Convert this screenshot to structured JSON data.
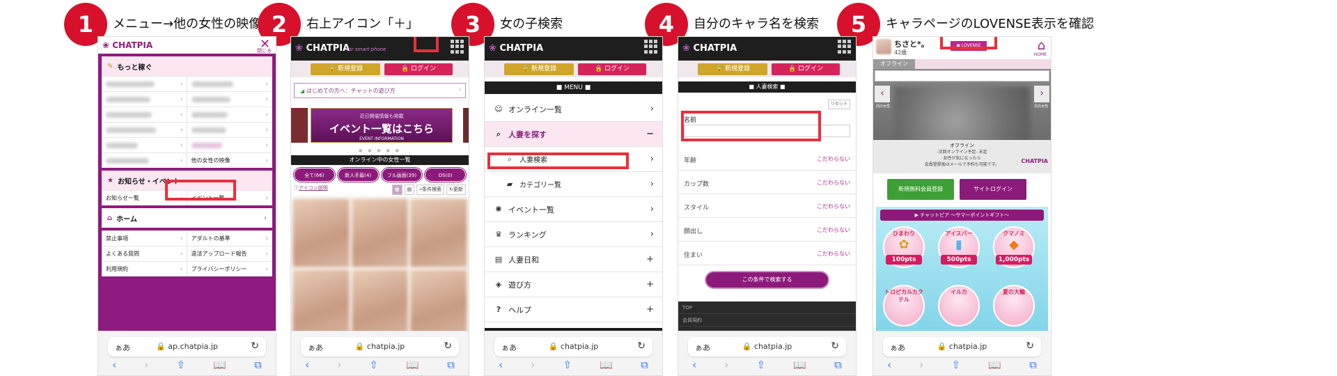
{
  "steps": [
    {
      "number": "1",
      "caption": "メニュー→他の女性の映像"
    },
    {
      "number": "2",
      "caption": "右上アイコン「＋」"
    },
    {
      "number": "3",
      "caption": "女の子検索"
    },
    {
      "number": "4",
      "caption": "自分のキャラ名を検索"
    },
    {
      "number": "5",
      "caption": "キャラページのLOVENSE表示を確認"
    }
  ],
  "colors": {
    "accent": "#d7112b",
    "brand": "#8e1b7f",
    "highlight": "#e8303a"
  },
  "browser": {
    "aa_label": "ぁあ",
    "reload_icon": "reload-icon",
    "back": "‹",
    "forward": "›",
    "share": "⇧",
    "bookmarks": "📖",
    "tabs": "⧉"
  },
  "phone1": {
    "logo": "CHATPIA",
    "close_label": "閉じる",
    "sections": [
      {
        "title": "もっと稼ぐ",
        "cells": [
          "",
          "",
          "",
          "",
          "",
          "",
          "",
          "",
          "",
          "",
          "",
          "他の女性の映像"
        ]
      },
      {
        "title": "お知らせ・イベント",
        "cells": [
          "お知らせ一覧",
          "イベント一覧"
        ]
      },
      {
        "title": "ホーム",
        "cells": []
      },
      {
        "title": "",
        "cells": [
          "禁止事項",
          "アダルトの基準",
          "よくある質問",
          "違法アップロード報告",
          "利用規約",
          "プライバシーポリシー"
        ]
      }
    ],
    "url": "ap.chatpia.jp"
  },
  "phone2": {
    "logo": "CHATPIA",
    "tagline": "for smart phone",
    "register": "新規登録",
    "login": "ログイン",
    "info_link": "はじめての方へ：チャットの遊び方",
    "banner_small": "近日開催情報も掲載",
    "banner_big": "イベント一覧はこちら",
    "banner_en": "EVENT INFORMATION",
    "online_title": "オンライン中の女性一覧",
    "pills": [
      "全て(66)",
      "新人手篇(4)",
      "フル画面(39)",
      "DS(0)"
    ],
    "icon_help": "アイコン説明",
    "cond_search": "条件検索",
    "refresh": "更新",
    "url": "chatpia.jp"
  },
  "phone3": {
    "logo": "CHATPIA",
    "register": "新規登録",
    "login": "ログイン",
    "menu_title": "MENU",
    "items": [
      {
        "label": "オンライン一覧",
        "end": "›",
        "icon": "user-icon"
      },
      {
        "label": "人妻を探す",
        "end": "−",
        "icon": "search-icon"
      },
      {
        "label": "人妻検索",
        "end": "›",
        "icon": "search-icon"
      },
      {
        "label": "カテゴリー覧",
        "end": "›",
        "icon": "folder-icon"
      },
      {
        "label": "イベント一覧",
        "end": "›",
        "icon": "party-icon"
      },
      {
        "label": "ランキング",
        "end": "›",
        "icon": "crown-icon"
      },
      {
        "label": "人妻日和",
        "end": "+",
        "icon": "book-icon"
      },
      {
        "label": "遊び方",
        "end": "+",
        "icon": "shield-icon"
      },
      {
        "label": "ヘルプ",
        "end": "+",
        "icon": "question-icon"
      }
    ],
    "url": "chatpia.jp"
  },
  "phone4": {
    "logo": "CHATPIA",
    "register": "新規登録",
    "login": "ログイン",
    "search_title": "人妻検索",
    "reset": "リセット",
    "name_label": "名前",
    "filters": [
      {
        "label": "年齢",
        "value": "こだわらない"
      },
      {
        "label": "カップ数",
        "value": "こだわらない"
      },
      {
        "label": "スタイル",
        "value": "こだわらない"
      },
      {
        "label": "顔出し",
        "value": "こだわらない"
      },
      {
        "label": "住まい",
        "value": "こだわらない"
      }
    ],
    "search_button": "この条件で検索する",
    "footer": [
      "TOP",
      "会員規約"
    ],
    "url": "chatpia.jp"
  },
  "phone5": {
    "name": "ちさと*。",
    "age": "42歳",
    "lovense": "LOVENSE",
    "home": "HOME",
    "offline": "オフライン",
    "prev": "前の女性",
    "next": "次の女性",
    "off_title": "オフライン",
    "off_line1": "-次回オンライン予定- 未定",
    "off_line2": "女性が気になったら",
    "off_line3": "会員登録後はメールで予約も可能です。",
    "brand": "CHATPIA",
    "signup": "新規無料会員登録",
    "sitelogin": "サイトログイン",
    "campaign": "チャットピア 〜サマーポイントギフト〜",
    "prizes": [
      {
        "name": "ひまわり",
        "pts": "100pts"
      },
      {
        "name": "アイスバー",
        "pts": "500pts"
      },
      {
        "name": "クマノミ",
        "pts": "1,000pts"
      }
    ],
    "prizes_row2": [
      "トロピカルカクテル",
      "イルカ",
      "夏の大輪"
    ],
    "url": "chatpia.jp"
  }
}
